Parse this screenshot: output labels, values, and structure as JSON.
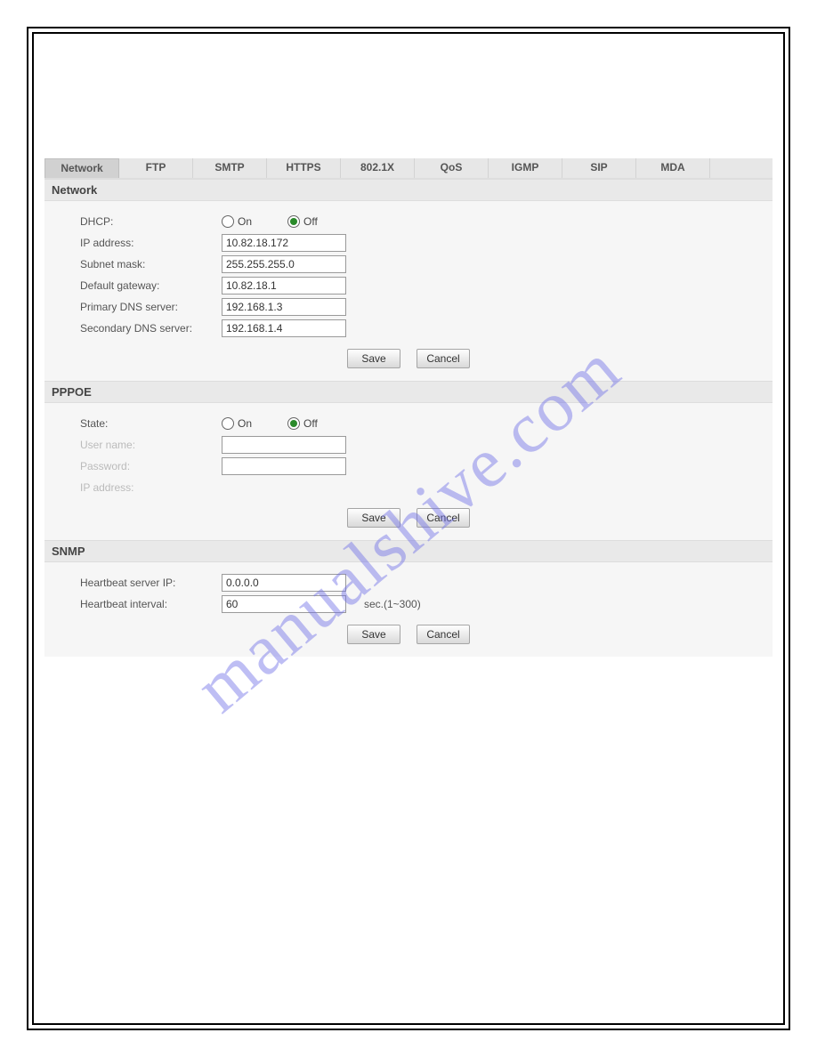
{
  "tabs": [
    "Network",
    "FTP",
    "SMTP",
    "HTTPS",
    "802.1X",
    "QoS",
    "IGMP",
    "SIP",
    "MDA"
  ],
  "active_tab_index": 0,
  "sections": {
    "network": {
      "title": "Network",
      "dhcp_label": "DHCP:",
      "dhcp_on": "On",
      "dhcp_off": "Off",
      "dhcp_value": "Off",
      "ip_label": "IP address:",
      "ip_value": "10.82.18.172",
      "mask_label": "Subnet mask:",
      "mask_value": "255.255.255.0",
      "gateway_label": "Default gateway:",
      "gateway_value": "10.82.18.1",
      "dns1_label": "Primary DNS server:",
      "dns1_value": "192.168.1.3",
      "dns2_label": "Secondary DNS server:",
      "dns2_value": "192.168.1.4",
      "save": "Save",
      "cancel": "Cancel"
    },
    "pppoe": {
      "title": "PPPOE",
      "state_label": "State:",
      "state_on": "On",
      "state_off": "Off",
      "state_value": "Off",
      "user_label": "User name:",
      "user_value": "",
      "pass_label": "Password:",
      "pass_value": "",
      "ip_label": "IP address:",
      "ip_value": "",
      "save": "Save",
      "cancel": "Cancel"
    },
    "snmp": {
      "title": "SNMP",
      "server_label": "Heartbeat server IP:",
      "server_value": "0.0.0.0",
      "interval_label": "Heartbeat interval:",
      "interval_value": "60",
      "interval_suffix": "sec.(1~300)",
      "save": "Save",
      "cancel": "Cancel"
    }
  },
  "watermark": "manualshive.com"
}
